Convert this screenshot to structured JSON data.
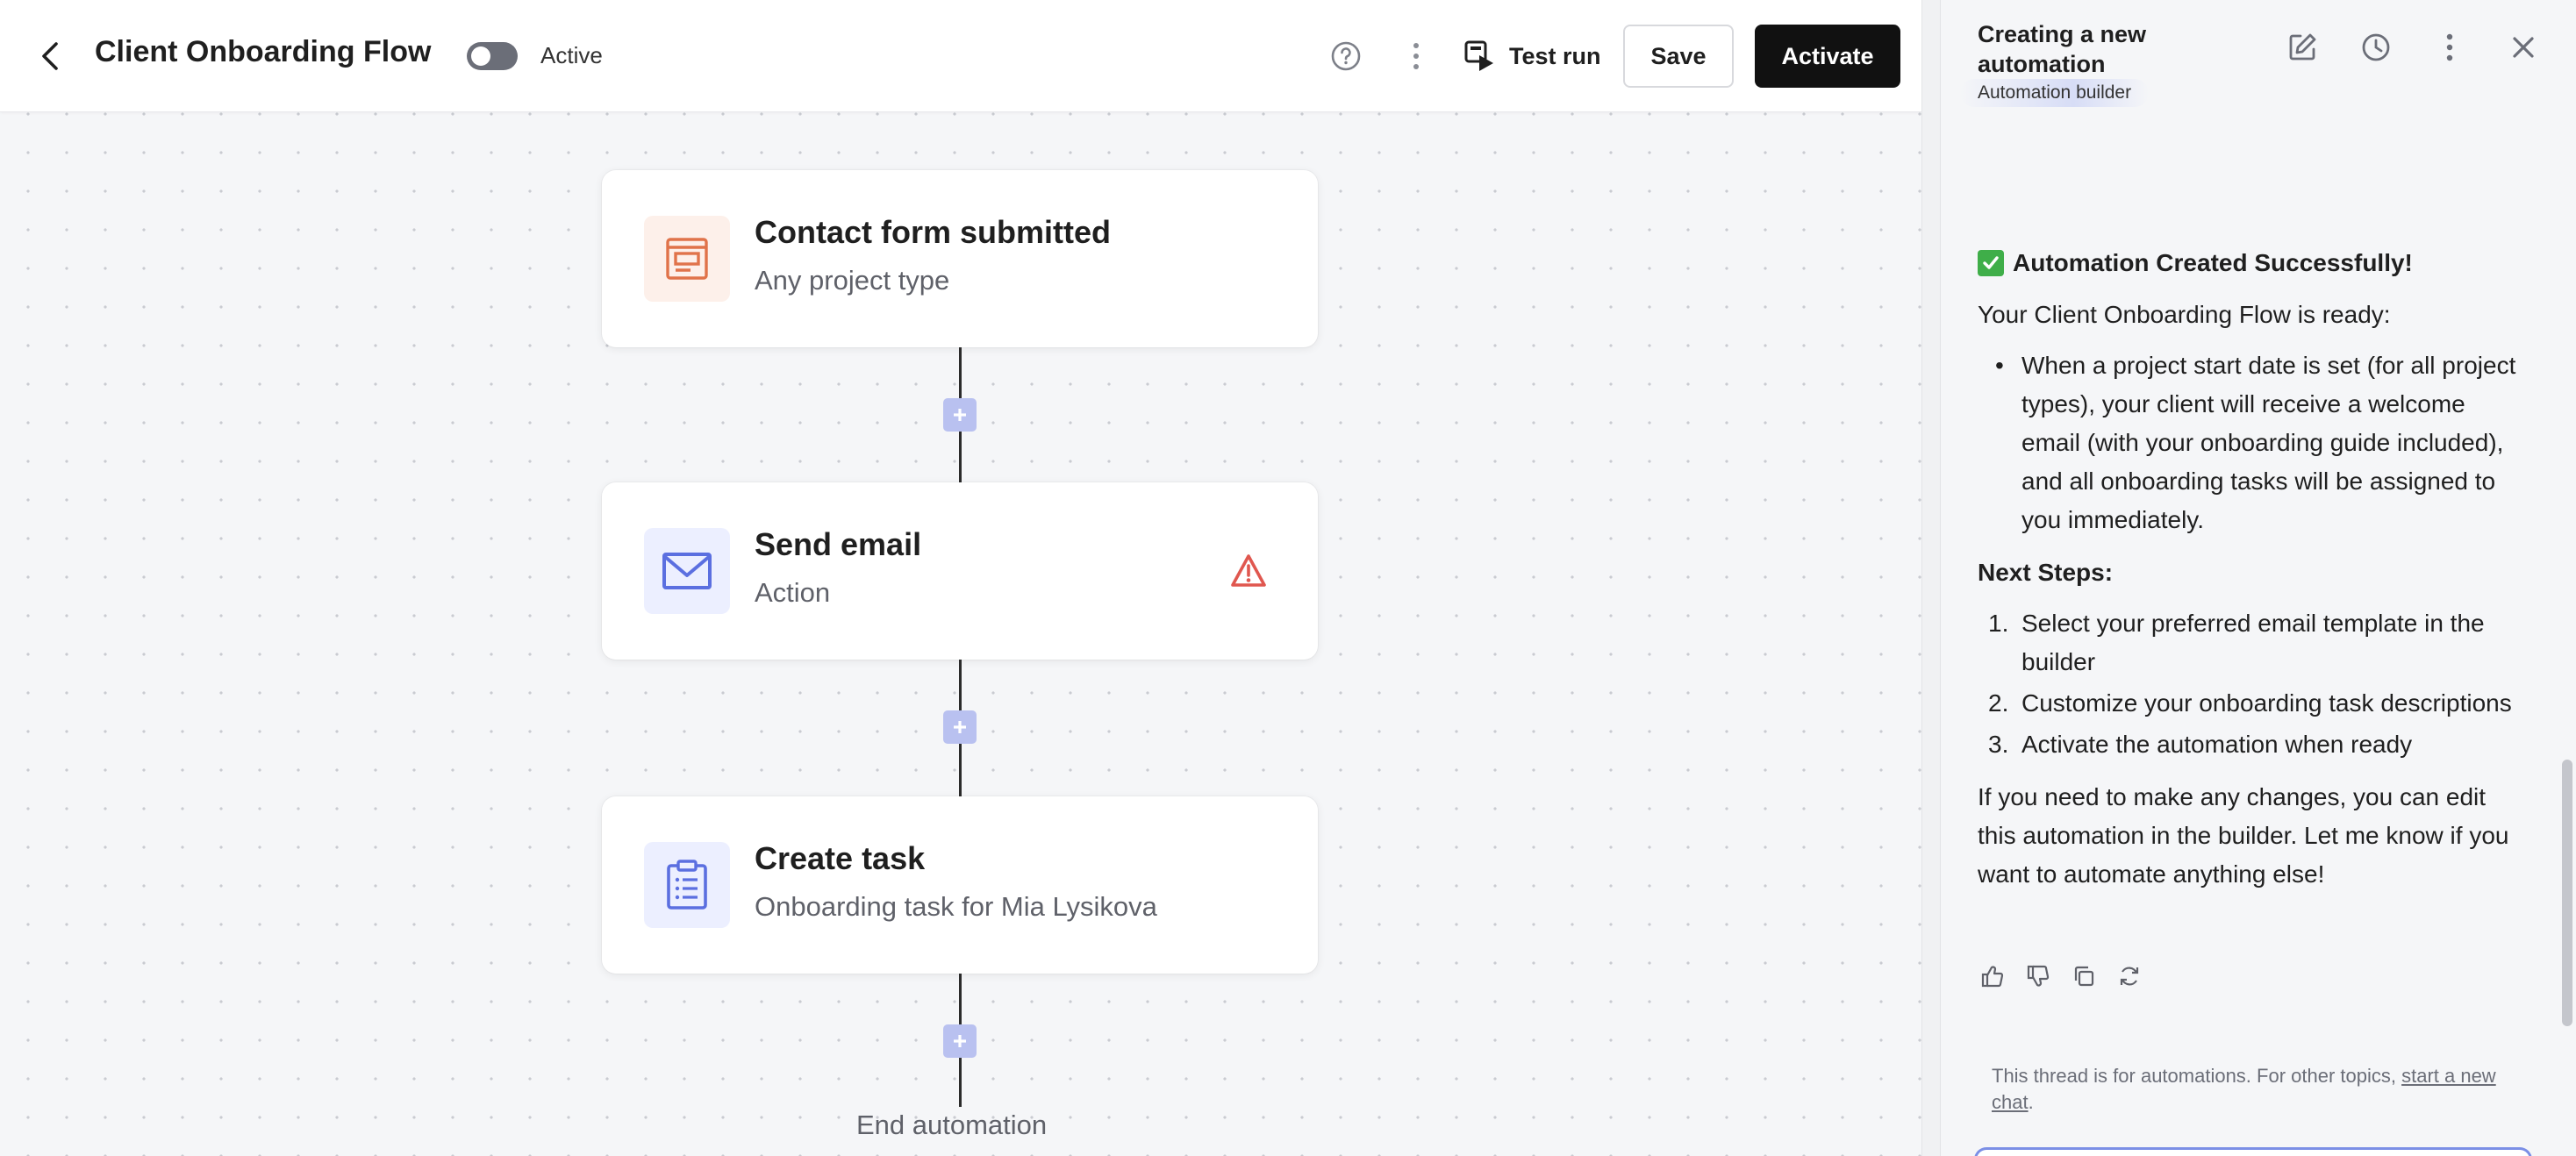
{
  "header": {
    "title": "Client Onboarding Flow",
    "toggle_label": "Active",
    "test_run_label": "Test run",
    "save_label": "Save",
    "activate_label": "Activate"
  },
  "flow": {
    "nodes": [
      {
        "title": "Contact form submitted",
        "subtitle": "Any project type",
        "icon": "form-icon"
      },
      {
        "title": "Send email",
        "subtitle": "Action",
        "icon": "envelope-icon",
        "warning": true
      },
      {
        "title": "Create task",
        "subtitle": "Onboarding task for Mia Lysikova",
        "icon": "clipboard-icon"
      }
    ],
    "end_label": "End automation"
  },
  "panel": {
    "title": "Creating a new automation",
    "subtitle": "Automation builder",
    "message": {
      "heading": "Automation Created Successfully!",
      "intro": "Your Client Onboarding Flow is ready:",
      "bullets": [
        "When a project start date is set (for all project types), your client will receive a welcome email (with your onboarding guide included), and all onboarding tasks will be assigned to you immediately."
      ],
      "next_steps_label": "Next Steps:",
      "steps": [
        {
          "num": "1.",
          "text": "Select your preferred email template in the builder"
        },
        {
          "num": "2.",
          "text": "Customize your onboarding task descriptions"
        },
        {
          "num": "3.",
          "text": "Activate the automation when ready"
        }
      ],
      "closing": "If you need to make any changes, you can edit this automation in the builder. Let me know if you want to automate anything else!"
    },
    "footnote_text": "This thread is for automations. For other topics, ",
    "footnote_link": "start a new chat",
    "footnote_end": "."
  },
  "colors": {
    "accent": "#6b7fe0",
    "form_icon": "#e0734a",
    "warning": "#e0574f",
    "success": "#3fae49"
  }
}
